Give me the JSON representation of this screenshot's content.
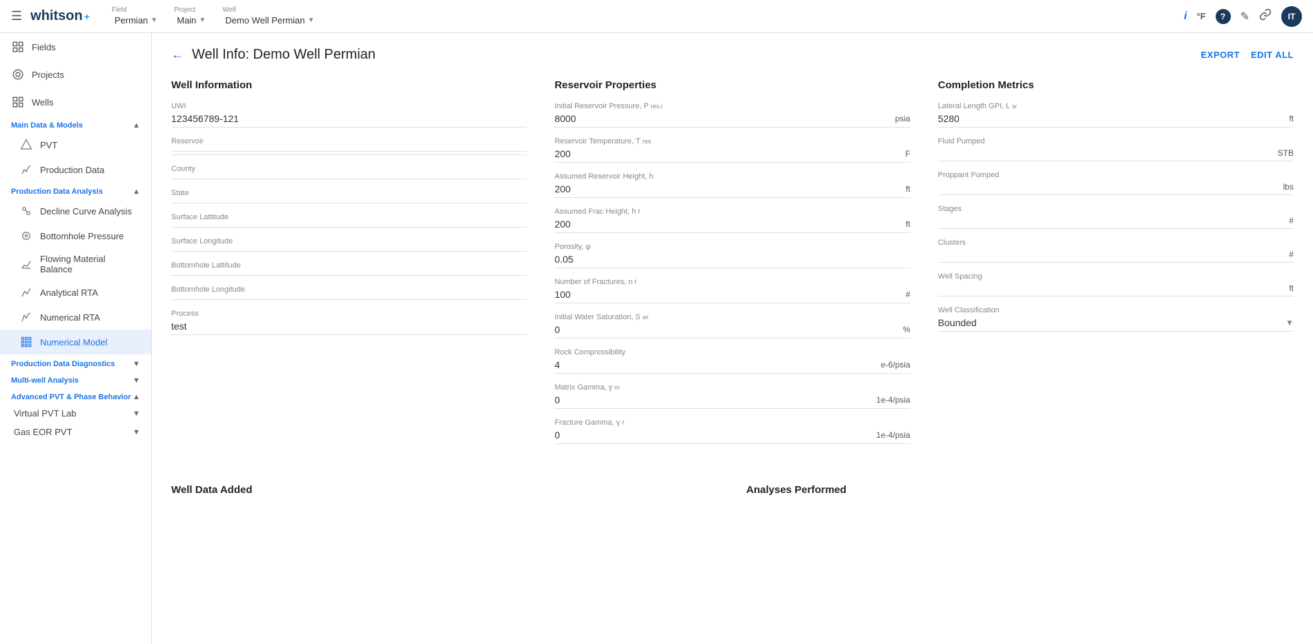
{
  "topnav": {
    "hamburger_label": "☰",
    "logo_text": "whitson",
    "logo_plus": "+",
    "field_label": "Field",
    "field_value": "Permian",
    "project_label": "Project",
    "project_value": "Main",
    "well_label": "Well",
    "well_value": "Demo Well Permian",
    "icons": {
      "info": "ℹ",
      "temp": "°F",
      "help": "?",
      "edit": "✎",
      "link": "🔗",
      "avatar": "IT"
    }
  },
  "sidebar": {
    "top_items": [
      {
        "id": "fields",
        "label": "Fields",
        "icon": "⊞"
      },
      {
        "id": "projects",
        "label": "Projects",
        "icon": "◎"
      },
      {
        "id": "wells",
        "label": "Wells",
        "icon": "⊞"
      }
    ],
    "sections": [
      {
        "id": "main-data-models",
        "title": "Main Data & Models",
        "expanded": true,
        "items": [
          {
            "id": "pvt",
            "label": "PVT",
            "icon": "⬡"
          },
          {
            "id": "production-data",
            "label": "Production Data",
            "icon": "〜"
          }
        ]
      },
      {
        "id": "production-data-analysis",
        "title": "Production Data Analysis",
        "expanded": true,
        "items": [
          {
            "id": "decline-curve-analysis",
            "label": "Decline Curve Analysis",
            "icon": "⊛"
          },
          {
            "id": "bottomhole-pressure",
            "label": "Bottomhole Pressure",
            "icon": "◎"
          },
          {
            "id": "flowing-material-balance",
            "label": "Flowing Material Balance",
            "icon": "⊾"
          },
          {
            "id": "analytical-rta",
            "label": "Analytical RTA",
            "icon": "〜"
          },
          {
            "id": "numerical-rta",
            "label": "Numerical RTA",
            "icon": "⊿"
          },
          {
            "id": "numerical-model",
            "label": "Numerical Model",
            "icon": "⊞",
            "active": true
          }
        ]
      },
      {
        "id": "production-data-diagnostics",
        "title": "Production Data Diagnostics",
        "expanded": false,
        "items": []
      },
      {
        "id": "multi-well-analysis",
        "title": "Multi-well Analysis",
        "expanded": false,
        "items": []
      },
      {
        "id": "advanced-pvt-phase-behavior",
        "title": "Advanced PVT & Phase Behavior",
        "expanded": true,
        "items": [
          {
            "id": "virtual-pvt-lab",
            "label": "Virtual PVT Lab",
            "icon": "",
            "hasArrow": true
          },
          {
            "id": "gas-eor-pvt",
            "label": "Gas EOR PVT",
            "icon": "",
            "hasArrow": true
          }
        ]
      }
    ]
  },
  "page": {
    "back_icon": "←",
    "title": "Well Info: Demo Well Permian",
    "export_label": "EXPORT",
    "edit_all_label": "EDIT ALL"
  },
  "well_information": {
    "section_title": "Well Information",
    "fields": [
      {
        "label": "UWI",
        "value": "123456789-121",
        "unit": ""
      },
      {
        "label": "Reservoir",
        "value": "",
        "unit": ""
      },
      {
        "label": "County",
        "value": "",
        "unit": ""
      },
      {
        "label": "State",
        "value": "",
        "unit": ""
      },
      {
        "label": "Surface Lattitude",
        "value": "",
        "unit": ""
      },
      {
        "label": "Surface Longitude",
        "value": "",
        "unit": ""
      },
      {
        "label": "Bottomhole Lattitude",
        "value": "",
        "unit": ""
      },
      {
        "label": "Bottomhole Longitude",
        "value": "",
        "unit": ""
      },
      {
        "label": "Process",
        "value": "test",
        "unit": ""
      }
    ]
  },
  "reservoir_properties": {
    "section_title": "Reservoir Properties",
    "fields": [
      {
        "label": "Initial Reservoir Pressure, P",
        "label_sub": "res,i",
        "value": "8000",
        "unit": "psia"
      },
      {
        "label": "Reservoir Temperature, T",
        "label_sub": "res",
        "value": "200",
        "unit": "F"
      },
      {
        "label": "Assumed Reservoir Height, h",
        "label_sub": "",
        "value": "200",
        "unit": "ft"
      },
      {
        "label": "Assumed Frac Height, h",
        "label_sub": "f",
        "value": "200",
        "unit": "ft"
      },
      {
        "label": "Porosity, φ",
        "label_sub": "",
        "value": "0.05",
        "unit": ""
      },
      {
        "label": "Number of Fractures, n",
        "label_sub": "f",
        "value": "100",
        "unit": "#"
      },
      {
        "label": "Initial Water Saturation, S",
        "label_sub": "wi",
        "value": "0",
        "unit": "%"
      },
      {
        "label": "Rock Compressibility",
        "label_sub": "",
        "value": "4",
        "unit": "e-6/psia"
      },
      {
        "label": "Matrix Gamma, γ",
        "label_sub": "m",
        "value": "0",
        "unit": "1e-4/psia"
      },
      {
        "label": "Fracture Gamma, γ",
        "label_sub": "f",
        "value": "0",
        "unit": "1e-4/psia"
      }
    ]
  },
  "completion_metrics": {
    "section_title": "Completion Metrics",
    "fields": [
      {
        "label": "Lateral Length GPI, L",
        "label_sub": "w",
        "value": "5280",
        "unit": "ft"
      },
      {
        "label": "Fluid Pumped",
        "label_sub": "",
        "value": "",
        "unit": "STB"
      },
      {
        "label": "Proppant Pumped",
        "label_sub": "",
        "value": "",
        "unit": "lbs"
      },
      {
        "label": "Stages",
        "label_sub": "",
        "value": "",
        "unit": "#"
      },
      {
        "label": "Clusters",
        "label_sub": "",
        "value": "",
        "unit": "#"
      },
      {
        "label": "Well Spacing",
        "label_sub": "",
        "value": "",
        "unit": "ft"
      },
      {
        "label": "Well Classification",
        "label_sub": "",
        "value": "Bounded",
        "unit": "",
        "type": "select"
      }
    ]
  },
  "bottom_sections": {
    "well_data_added": "Well Data Added",
    "analyses_performed": "Analyses Performed"
  }
}
